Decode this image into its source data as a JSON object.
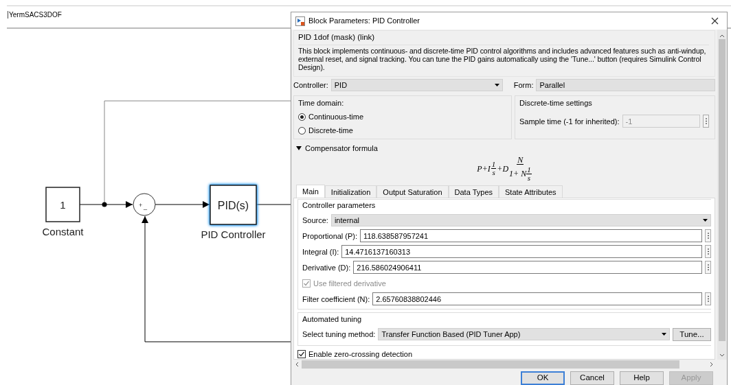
{
  "model_tab": {
    "title": "YermSACS3DOF"
  },
  "diagram": {
    "blocks": [
      {
        "kind": "constant",
        "text": "1",
        "label": "Constant",
        "selected": false
      },
      {
        "kind": "sum",
        "signs": [
          "+",
          "_"
        ],
        "selected": false
      },
      {
        "kind": "pid",
        "text": "PID(s)",
        "label": "PID Controller",
        "selected": true
      }
    ]
  },
  "dialog": {
    "title": "Block Parameters: PID Controller",
    "mask_title": "PID 1dof (mask) (link)",
    "description": "This block implements continuous- and discrete-time PID control algorithms and includes advanced features such as anti-windup, external reset, and signal tracking. You can tune the PID gains automatically using the 'Tune...' button (requires Simulink Control Design).",
    "controller": {
      "label": "Controller:",
      "value": "PID"
    },
    "form": {
      "label": "Form:",
      "value": "Parallel"
    },
    "time_domain": {
      "title": "Time domain:",
      "options": [
        {
          "label": "Continuous-time",
          "selected": true
        },
        {
          "label": "Discrete-time",
          "selected": false
        }
      ]
    },
    "discrete_settings": {
      "title": "Discrete-time settings",
      "sample_time": {
        "label": "Sample time (-1 for inherited):",
        "value": "-1",
        "disabled": true
      }
    },
    "compensator": {
      "label": "Compensator formula",
      "expanded": true,
      "formula": {
        "lead": "P+I",
        "f1_num": "1",
        "f1_den": "s",
        "mid": "+D",
        "f2_num": "N",
        "f2_den": "1+ N",
        "f3_num": "1",
        "f3_den": "s"
      }
    },
    "tabs": [
      {
        "label": "Main",
        "selected": true
      },
      {
        "label": "Initialization",
        "selected": false
      },
      {
        "label": "Output Saturation",
        "selected": false
      },
      {
        "label": "Data Types",
        "selected": false
      },
      {
        "label": "State Attributes",
        "selected": false
      }
    ],
    "controller_parameters": {
      "title": "Controller parameters",
      "source": {
        "label": "Source:",
        "value": "internal"
      },
      "rows": [
        {
          "kind": "field",
          "label": "Proportional (P):",
          "value": "118.638587957241"
        },
        {
          "kind": "field",
          "label": "Integral (I):",
          "value": "14.4716137160313"
        },
        {
          "kind": "field",
          "label": "Derivative (D):",
          "value": "216.586024906411"
        },
        {
          "kind": "checkbox",
          "label": "Use filtered derivative",
          "checked": true,
          "disabled": true
        },
        {
          "kind": "field",
          "label": "Filter coefficient (N):",
          "value": "2.65760838802446"
        }
      ]
    },
    "automated_tuning": {
      "title": "Automated tuning",
      "method": {
        "label": "Select tuning method:",
        "value": "Transfer Function Based (PID Tuner App)"
      },
      "tune_button": "Tune..."
    },
    "zero_crossing": {
      "label": "Enable zero-crossing detection",
      "checked": true
    },
    "buttons": [
      {
        "label": "OK",
        "default": true,
        "disabled": false
      },
      {
        "label": "Cancel",
        "default": false,
        "disabled": false
      },
      {
        "label": "Help",
        "default": false,
        "disabled": false
      },
      {
        "label": "Apply",
        "default": false,
        "disabled": true
      }
    ]
  }
}
